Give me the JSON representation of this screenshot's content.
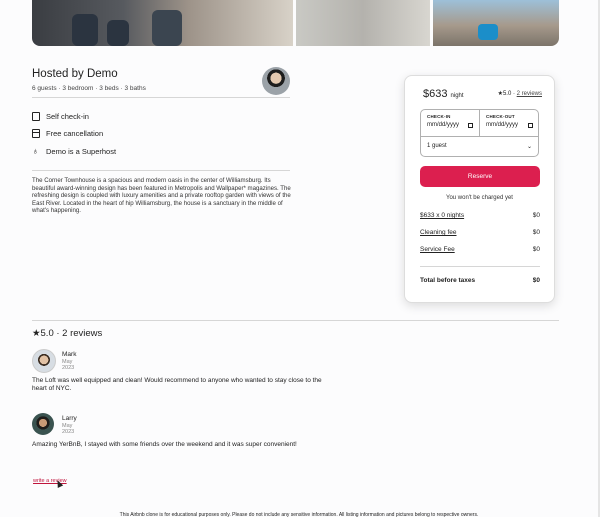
{
  "host": {
    "title": "Hosted by Demo",
    "subtitle": "6 guests · 3 bedroom · 3 beds · 3 baths"
  },
  "features": [
    {
      "icon": "door-icon",
      "label": "Self check-in"
    },
    {
      "icon": "calendar-icon",
      "label": "Free cancellation"
    },
    {
      "icon": "medal-icon",
      "label": "Demo is a Superhost"
    }
  ],
  "description": "The Corner Townhouse is a spacious and modern oasis in the center of Williamsburg. Its beautiful award-winning design has been featured in Metropolis and Wallpaper* magazines. The refreshing design is coupled with luxury amenities and a private rooftop garden with views of the East River. Located in the heart of hip Williamsburg, the house is a sanctuary in the middle of what's happening.",
  "booking": {
    "price": "$633",
    "per": "night",
    "rating": "★5.0 ·",
    "reviews_link": "2 reviews",
    "checkin_label": "CHECK-IN",
    "checkout_label": "CHECK-OUT",
    "date_placeholder": "mm/dd/yyyy",
    "guests_value": "1 guest",
    "reserve_label": "Reserve",
    "no_charge": "You won't be charged yet",
    "nights_label": "$633 x 0 nights",
    "nights_value": "$0",
    "cleaning_label": "Cleaning fee",
    "cleaning_value": "$0",
    "service_label": "Service Fee",
    "service_value": "$0",
    "total_label": "Total before taxes",
    "total_value": "$0"
  },
  "reviews_section": {
    "heading": "★5.0 · 2 reviews",
    "items": [
      {
        "name": "Mark",
        "date": "May 2023",
        "text": "The Loft was well equipped and clean! Would recommend to anyone who wanted to stay close to the heart of NYC."
      },
      {
        "name": "Larry",
        "date": "May 2023",
        "text": "Amazing YerBnB, I stayed with some friends over the weekend and it was super convenient!"
      }
    ],
    "write_link": "write a review"
  },
  "footer": "This Airbnb clone is for educational purposes only. Please do not include any sensitive information. All listing information and pictures belong to respective owners.",
  "colors": {
    "accent": "#dc1f4f"
  }
}
